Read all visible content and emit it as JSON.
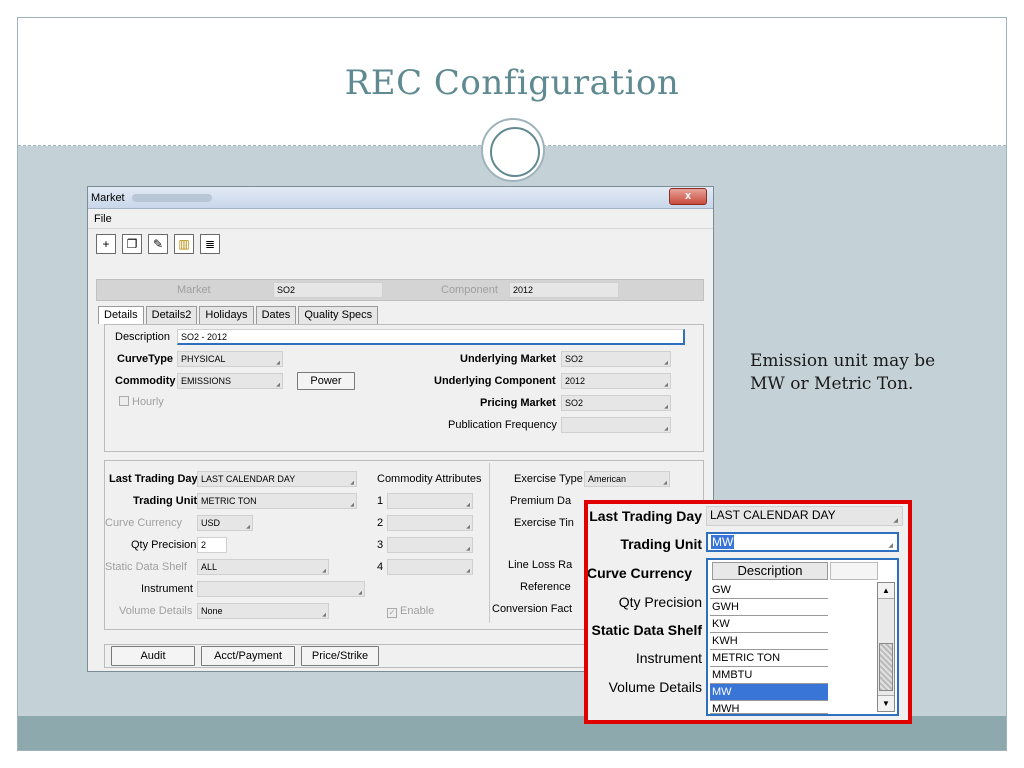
{
  "slide": {
    "title": "REC Configuration",
    "note_line1": "Emission unit may be",
    "note_line2": "MW or Metric Ton."
  },
  "window": {
    "title": "Market",
    "close_glyph": "x",
    "menu": [
      "File"
    ],
    "toolbar_icons": [
      "new-doc-icon",
      "copy-doc-icon",
      "edit-doc-icon",
      "delete-trash-icon",
      "report-doc-icon"
    ],
    "header": {
      "market_label": "Market",
      "market_value": "SO2",
      "component_label": "Component",
      "component_value": "2012"
    },
    "tabs": [
      "Details",
      "Details2",
      "Holidays",
      "Dates",
      "Quality Specs"
    ],
    "details": {
      "description_label": "Description",
      "description_value": "SO2 - 2012",
      "curvetype_label": "CurveType",
      "curvetype_value": "PHYSICAL",
      "commodity_label": "Commodity",
      "commodity_value": "EMISSIONS",
      "power_button": "Power",
      "hourly_label": "Hourly",
      "underlying_market_label": "Underlying Market",
      "underlying_market_value": "SO2",
      "underlying_component_label": "Underlying Component",
      "underlying_component_value": "2012",
      "pricing_market_label": "Pricing Market",
      "pricing_market_value": "SO2",
      "publication_frequency_label": "Publication Frequency",
      "publication_frequency_value": ""
    },
    "lower": {
      "last_trading_day_label": "Last Trading Day",
      "last_trading_day_value": "LAST CALENDAR DAY",
      "trading_unit_label": "Trading Unit",
      "trading_unit_value": "METRIC TON",
      "curve_currency_label": "Curve Currency",
      "curve_currency_value": "USD",
      "qty_precision_label": "Qty Precision",
      "qty_precision_value": "2",
      "static_data_shelf_label": "Static Data Shelf",
      "static_data_shelf_value": "ALL",
      "instrument_label": "Instrument",
      "instrument_value": "",
      "volume_details_label": "Volume Details",
      "volume_details_value": "None",
      "commodity_attributes_label": "Commodity Attributes",
      "attr_nums": [
        "1",
        "2",
        "3",
        "4"
      ],
      "enable_label": "Enable",
      "exercise_type_label": "Exercise Type",
      "exercise_type_value": "American",
      "premium_label": "Premium Da",
      "exercise_time_label": "Exercise Tin",
      "line_loss_label": "Line Loss Ra",
      "reference_label": "Reference",
      "conversion_label": "Conversion Fact"
    },
    "bottom_buttons": [
      "Audit",
      "Acct/Payment",
      "Price/Strike"
    ]
  },
  "zoom": {
    "last_trading_day_label": "Last Trading Day",
    "last_trading_day_value": "LAST CALENDAR DAY",
    "trading_unit_label": "Trading Unit",
    "trading_unit_value": "MW",
    "curve_currency_label": "Curve Currency",
    "qty_precision_label": "Qty Precision",
    "static_data_shelf_label": "Static Data Shelf",
    "instrument_label": "Instrument",
    "volume_details_label": "Volume Details",
    "list_header": "Description",
    "list_items": [
      "GW",
      "GWH",
      "KW",
      "KWH",
      "METRIC TON",
      "MMBTU",
      "MW",
      "MWH"
    ],
    "selected_item": "MW"
  },
  "colors": {
    "title": "#5f8a91",
    "highlight_border": "#e00000",
    "selection": "#3875d7"
  }
}
